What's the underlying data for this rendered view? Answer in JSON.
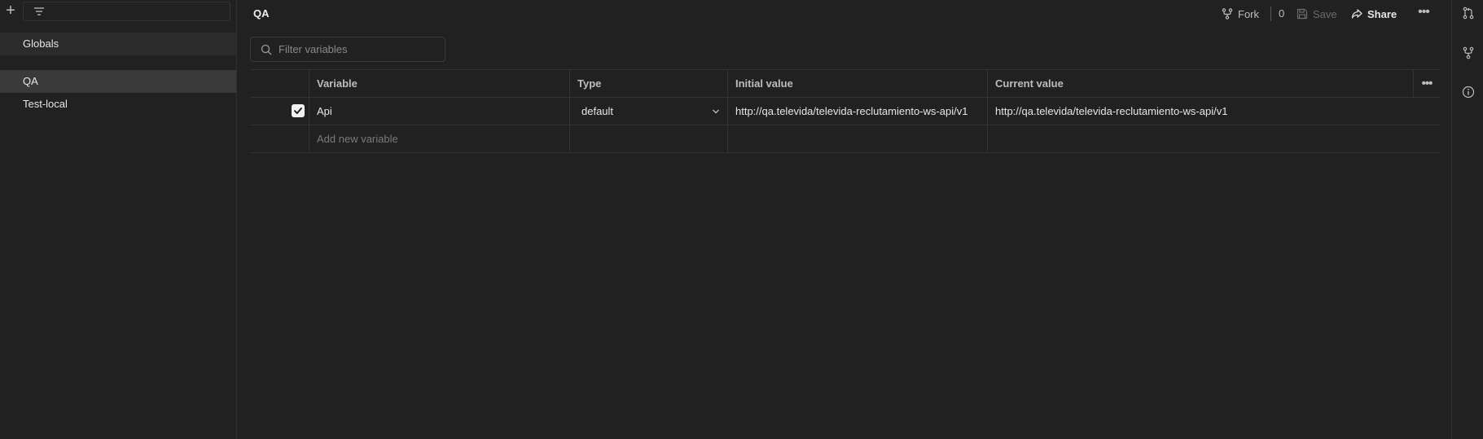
{
  "sidebar": {
    "add_icon": "plus-icon",
    "filter_icon": "filter-icon",
    "items": [
      {
        "label": "Globals"
      },
      {
        "label": "QA"
      },
      {
        "label": "Test-local"
      }
    ]
  },
  "environment": {
    "title": "QA"
  },
  "toolbar": {
    "fork_label": "Fork",
    "fork_count": "0",
    "save_label": "Save",
    "share_label": "Share",
    "more_icon": "more-horizontal-icon"
  },
  "search": {
    "placeholder": "Filter variables"
  },
  "table": {
    "headers": {
      "variable": "Variable",
      "type": "Type",
      "initial": "Initial value",
      "current": "Current value"
    },
    "rows": [
      {
        "enabled": true,
        "variable": "Api",
        "type": "default",
        "initial": "http://qa.televida/televida-reclutamiento-ws-api/v1",
        "current": "http://qa.televida/televida-reclutamiento-ws-api/v1"
      }
    ],
    "add_placeholder": "Add new variable"
  },
  "rightbar": {
    "icons": [
      "pull-request-icon",
      "fork-icon",
      "info-icon"
    ]
  },
  "colors": {
    "background": "#212121",
    "selected_item": "#3a3a3a",
    "text": "#e6e6e6",
    "muted": "#7a7a7a"
  }
}
